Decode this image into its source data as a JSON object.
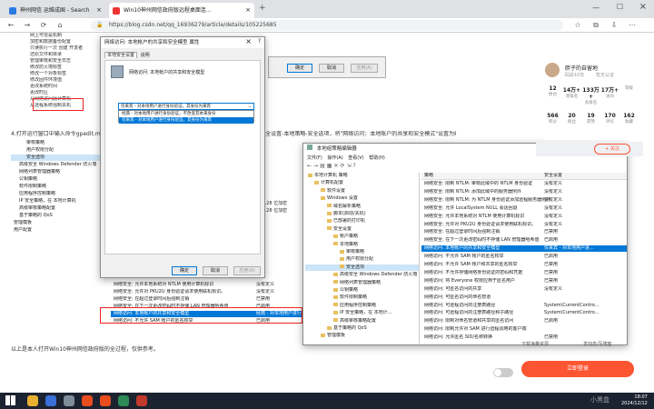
{
  "browser": {
    "tabs": [
      {
        "label": "神州网信 运维成国 - Search",
        "active": false
      },
      {
        "label": "Win10神州网信政府版远程桌面连…",
        "active": true
      }
    ],
    "url": "https://blog.csdn.net/qq_16936279/article/details/105225685"
  },
  "article": {
    "top_tree": [
      "网上可信是机制",
      "加密和数据备份配置",
      "只读执行一次 创建 开发者",
      "还原文件和目录",
      "管理审核和安全日志",
      "修改防火墙标签",
      "修改一个对象标签",
      "修改固件环境值",
      "更改系统时间",
      "更改时区",
      "从网络访问此计算机",
      "从远程系统强制关机"
    ],
    "top_tree_right": [
      "还原文件和目录",
      "从本地登录"
    ],
    "step4_text": "4.打开运行窗口中输入命令gpedit.msc，打开本地组策略编辑器，依次展开计算机配置-Windows设置-安全设置-本地策略-安全选项，将\"网络访问：本地账户的共享和安全模式\"设置为经典:对本地用户进行…",
    "gp_tree": [
      "审核策略",
      "用户权限分配",
      "安全选项",
      "高级安全 Windows Defender 防火墙",
      "网络列表管理器策略",
      "公钥策略",
      "软件限制策略",
      "应用程序控制策略",
      "IP 安全策略，在 本地计算机",
      "高级审核策略配置",
      "基于策略的 QoS",
      "管理模板",
      "用户配置"
    ],
    "bits": [
      "128 位加密",
      "128 位加密"
    ],
    "policies": [
      {
        "name": "网络安全: 允许本地系统对 NTLM 使用计算机标识",
        "value": "没有定义"
      },
      {
        "name": "网络安全: 允许对 PKU2U 身份验证请求使用联机标识。",
        "value": "没有定义"
      },
      {
        "name": "网络安全: 在超过登录时间后强制注销",
        "value": "已禁用"
      },
      {
        "name": "网络安全: 在下一次更改密码时不存储 LAN 管理器哈希值",
        "value": "已启用"
      },
      {
        "name": "网络访问: 本地帐户的共享和安全模型",
        "value": "经典 - 对本地用户进行身份验证"
      },
      {
        "name": "网络访问: 不允许 SAM 帐户的匿名枚举",
        "value": "已启用"
      }
    ],
    "footer_text": "以上是本人打开Win10神州网信政府版的全过程，仅供参考。"
  },
  "dialog": {
    "title": "网络访问: 本地帐户的共享和安全模型 属性",
    "tabs": [
      "本地安全设置",
      "说明"
    ],
    "policy_name": "网络访问: 本地帐户的共享和安全模型",
    "selected_value": "仅来宾 - 对本地用户进行身份验证，其身份为来宾",
    "options": [
      "经典 - 对本地用户进行身份验证，不改变其本来身份",
      "仅来宾 - 对本地用户进行身份验证，其身份为来宾"
    ],
    "ok": "确定",
    "cancel": "取消",
    "apply": "应用(A)"
  },
  "back_dialog": {
    "ok": "确定",
    "cancel": "取消",
    "apply": "应用(A)"
  },
  "gpedit": {
    "title": "本地组策略编辑器",
    "menu": [
      "文件(F)",
      "操作(A)",
      "查看(V)",
      "帮助(H)"
    ],
    "tree": [
      {
        "label": "本地计算机 策略",
        "indent": 0,
        "sel": false
      },
      {
        "label": "计算机配置",
        "indent": 1,
        "sel": false
      },
      {
        "label": "软件设置",
        "indent": 2,
        "sel": false
      },
      {
        "label": "Windows 设置",
        "indent": 2,
        "sel": false
      },
      {
        "label": "域名解析策略",
        "indent": 3,
        "sel": false
      },
      {
        "label": "脚本(启动/关机)",
        "indent": 3,
        "sel": false
      },
      {
        "label": "已部署的打印机",
        "indent": 3,
        "sel": false
      },
      {
        "label": "安全设置",
        "indent": 3,
        "sel": false
      },
      {
        "label": "帐户策略",
        "indent": 4,
        "sel": false
      },
      {
        "label": "本地策略",
        "indent": 4,
        "sel": false
      },
      {
        "label": "审核策略",
        "indent": 5,
        "sel": false
      },
      {
        "label": "用户权限分配",
        "indent": 5,
        "sel": false
      },
      {
        "label": "安全选项",
        "indent": 5,
        "sel": true
      },
      {
        "label": "高级安全 Windows Defender 防火墙",
        "indent": 4,
        "sel": false
      },
      {
        "label": "网络列表管理器策略",
        "indent": 4,
        "sel": false
      },
      {
        "label": "公钥策略",
        "indent": 4,
        "sel": false
      },
      {
        "label": "软件限制策略",
        "indent": 4,
        "sel": false
      },
      {
        "label": "应用程序控制策略",
        "indent": 4,
        "sel": false
      },
      {
        "label": "IP 安全策略，在 本地计…",
        "indent": 4,
        "sel": false
      },
      {
        "label": "高级审核策略配置",
        "indent": 4,
        "sel": false
      },
      {
        "label": "基于策略的 QoS",
        "indent": 3,
        "sel": false
      },
      {
        "label": "管理模板",
        "indent": 2,
        "sel": false
      }
    ],
    "col_policy": "策略",
    "col_setting": "安全设置",
    "rows": [
      {
        "name": "网络安全: 限制 NTLM: 审核此域中的 NTLM 身份验证",
        "value": "没有定义",
        "sel": false
      },
      {
        "name": "网络安全: 限制 NTLM: 添加此域中的服务器例外",
        "value": "没有定义",
        "sel": false
      },
      {
        "name": "网络安全: 限制 NTLM: 为 NTLM 身份验证添加远程服务器例外",
        "value": "没有定义",
        "sel": false
      },
      {
        "name": "网络安全: 允许 LocalSystem NULL 会话回退",
        "value": "没有定义",
        "sel": false
      },
      {
        "name": "网络安全: 允许本地系统对 NTLM 使用计算机标识",
        "value": "没有定义",
        "sel": false
      },
      {
        "name": "网络安全: 允许对 PKU2U 身份验证请求使用联机标识。",
        "value": "没有定义",
        "sel": false
      },
      {
        "name": "网络安全: 在超过登录时间后强制注销",
        "value": "已禁用",
        "sel": false
      },
      {
        "name": "网络安全: 在下一次更改密码时不存储 LAN 管理器哈希值",
        "value": "已启用",
        "sel": false
      },
      {
        "name": "网络访问: 本地帐户的共享和安全模型",
        "value": "仅来宾 - 对本地用户进…",
        "sel": true
      },
      {
        "name": "网络访问: 不允许 SAM 帐户的匿名枚举",
        "value": "已启用",
        "sel": false
      },
      {
        "name": "网络访问: 不允许 SAM 帐户和共享的匿名枚举",
        "value": "已禁用",
        "sel": false
      },
      {
        "name": "网络访问: 不允许存储网络身份验证的密码和凭据",
        "value": "已禁用",
        "sel": false
      },
      {
        "name": "网络访问: 将 Everyone 权限应用于匿名用户",
        "value": "已禁用",
        "sel": false
      },
      {
        "name": "网络访问: 可匿名访问的共享",
        "value": "没有定义",
        "sel": false
      },
      {
        "name": "网络访问: 可匿名访问的命名管道",
        "value": "",
        "sel": false
      },
      {
        "name": "网络访问: 可远程访问的注册表路径",
        "value": "System\\CurrentContro…",
        "sel": false
      },
      {
        "name": "网络访问: 可远程访问的注册表路径和子路径",
        "value": "System\\CurrentContro…",
        "sel": false
      },
      {
        "name": "网络访问: 限制对命名管道和共享的匿名访问",
        "value": "已启用",
        "sel": false
      },
      {
        "name": "网络访问: 限制允许对 SAM 进行远程调用的客户端",
        "value": "",
        "sel": false
      },
      {
        "name": "网络访问: 允许匿名 SID/名称转换",
        "value": "已禁用",
        "sel": false
      }
    ]
  },
  "right_panel": {
    "username": "胖子的自留地",
    "user_sub": "码龄10年",
    "badge": "暂无认证",
    "stats1": [
      {
        "v": "12",
        "l": "原创"
      },
      {
        "v": "14万+",
        "l": "周排名"
      },
      {
        "v": "133万+",
        "l": "总排名"
      },
      {
        "v": "17万+",
        "l": "访问"
      },
      {
        "v": "",
        "l": "等级"
      }
    ],
    "stats2": [
      {
        "v": "566",
        "l": "积分"
      },
      {
        "v": "20",
        "l": "粉丝"
      },
      {
        "v": "19",
        "l": "获赞"
      },
      {
        "v": "170",
        "l": "评论"
      },
      {
        "v": "162",
        "l": "收藏"
      }
    ],
    "follow": "+ 关注",
    "download": "下载海量资源",
    "upload": "发动态/写博客",
    "login": "立即登录"
  },
  "taskbar": {
    "time": "18:07",
    "date": "2024/12/12",
    "watermark": "小黑盒"
  }
}
